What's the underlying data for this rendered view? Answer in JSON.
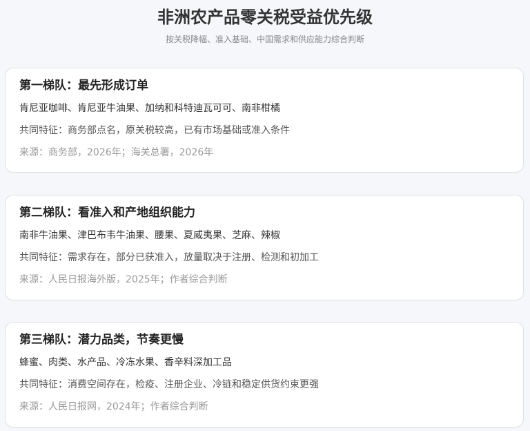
{
  "header": {
    "title": "非洲农产品零关税受益优先级",
    "subtitle": "按关税降幅、准入基础、中国需求和供应能力综合判断"
  },
  "tiers": [
    {
      "title": "第一梯队：最先形成订单",
      "items": "肯尼亚咖啡、肯尼亚牛油果、加纳和科特迪瓦可可、南非柑橘",
      "feature": "共同特征：商务部点名，原关税较高，已有市场基础或准入条件",
      "source": "来源：商务部，2026年；海关总署，2026年"
    },
    {
      "title": "第二梯队：看准入和产地组织能力",
      "items": "南非牛油果、津巴布韦牛油果、腰果、夏威夷果、芝麻、辣椒",
      "feature": "共同特征：需求存在，部分已获准入，放量取决于注册、检测和初加工",
      "source": "来源：人民日报海外版，2025年；作者综合判断"
    },
    {
      "title": "第三梯队：潜力品类，节奏更慢",
      "items": "蜂蜜、肉类、水产品、冷冻水果、香辛料深加工品",
      "feature": "共同特征：消费空间存在，检疫、注册企业、冷链和稳定供货约束更强",
      "source": "来源：人民日报网，2024年；作者综合判断"
    }
  ]
}
